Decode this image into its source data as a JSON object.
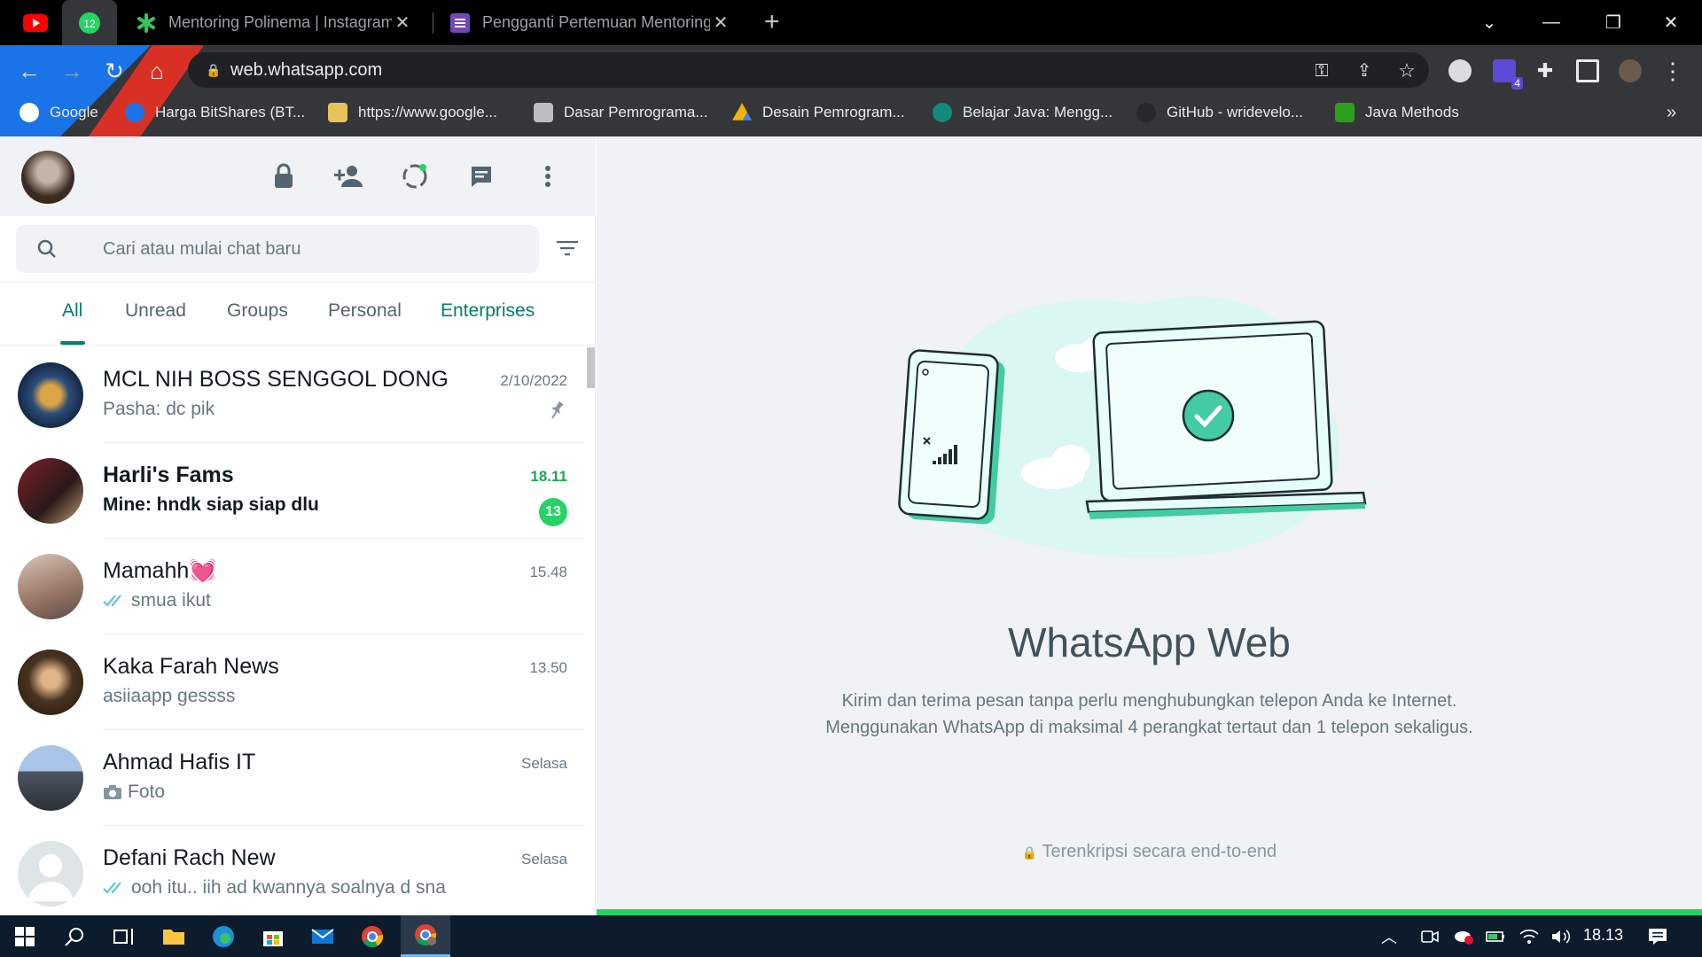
{
  "browser": {
    "tabs": [
      {
        "title": "Mentoring Polinema | Instagram,",
        "active": false
      },
      {
        "title": "Pengganti Pertemuan Mentoring",
        "active": false
      }
    ],
    "active_tab_badge": "12",
    "url": "web.whatsapp.com",
    "extension_badge": "4",
    "bookmarks": [
      "Google",
      "Harga BitShares (BT...",
      "https://www.google...",
      "Dasar Pemrograma...",
      "Desain Pemrogram...",
      "Belajar Java: Mengg...",
      "GitHub - wridevelo...",
      "Java Methods"
    ],
    "bookmarks_more": "»"
  },
  "whatsapp": {
    "search": {
      "placeholder": "Cari atau mulai chat baru"
    },
    "filters": [
      "All",
      "Unread",
      "Groups",
      "Personal",
      "Enterprises"
    ],
    "chats": [
      {
        "name": "MCL NIH BOSS SENGGOL DONG",
        "preview": "Pasha: dc pik",
        "time": "2/10/2022",
        "pinned": true,
        "unread": null,
        "bold": false
      },
      {
        "name": "Harli's Fams",
        "preview": "Mine: hndk siap siap dlu",
        "time": "18.11",
        "pinned": false,
        "unread": "13",
        "bold": true
      },
      {
        "name": "Mamahh💓",
        "preview": "smua ikut",
        "time": "15.48",
        "pinned": false,
        "unread": null,
        "bold": false,
        "ticks": true
      },
      {
        "name": "Kaka Farah News",
        "preview": "asiiaapp gessss",
        "time": "13.50",
        "pinned": false,
        "unread": null,
        "bold": false
      },
      {
        "name": "Ahmad Hafis IT",
        "preview": "Foto",
        "time": "Selasa",
        "pinned": false,
        "unread": null,
        "bold": false,
        "photo": true
      },
      {
        "name": "Defani Rach New",
        "preview": "ooh itu.. iih ad kwannya soalnya d sna",
        "time": "Selasa",
        "pinned": false,
        "unread": null,
        "bold": false,
        "ticks": true
      }
    ],
    "main": {
      "title": "WhatsApp Web",
      "description_line1": "Kirim dan terima pesan tanpa perlu menghubungkan telepon Anda ke Internet.",
      "description_line2": "Menggunakan WhatsApp di maksimal 4 perangkat tertaut dan 1 telepon sekaligus.",
      "footer": "Terenkripsi secara end-to-end"
    }
  },
  "taskbar": {
    "clock": "18.13"
  },
  "colors": {
    "wa_green": "#25d366",
    "wa_teal": "#008069",
    "unread_time": "#1fa855",
    "tick_blue": "#53bdeb"
  }
}
